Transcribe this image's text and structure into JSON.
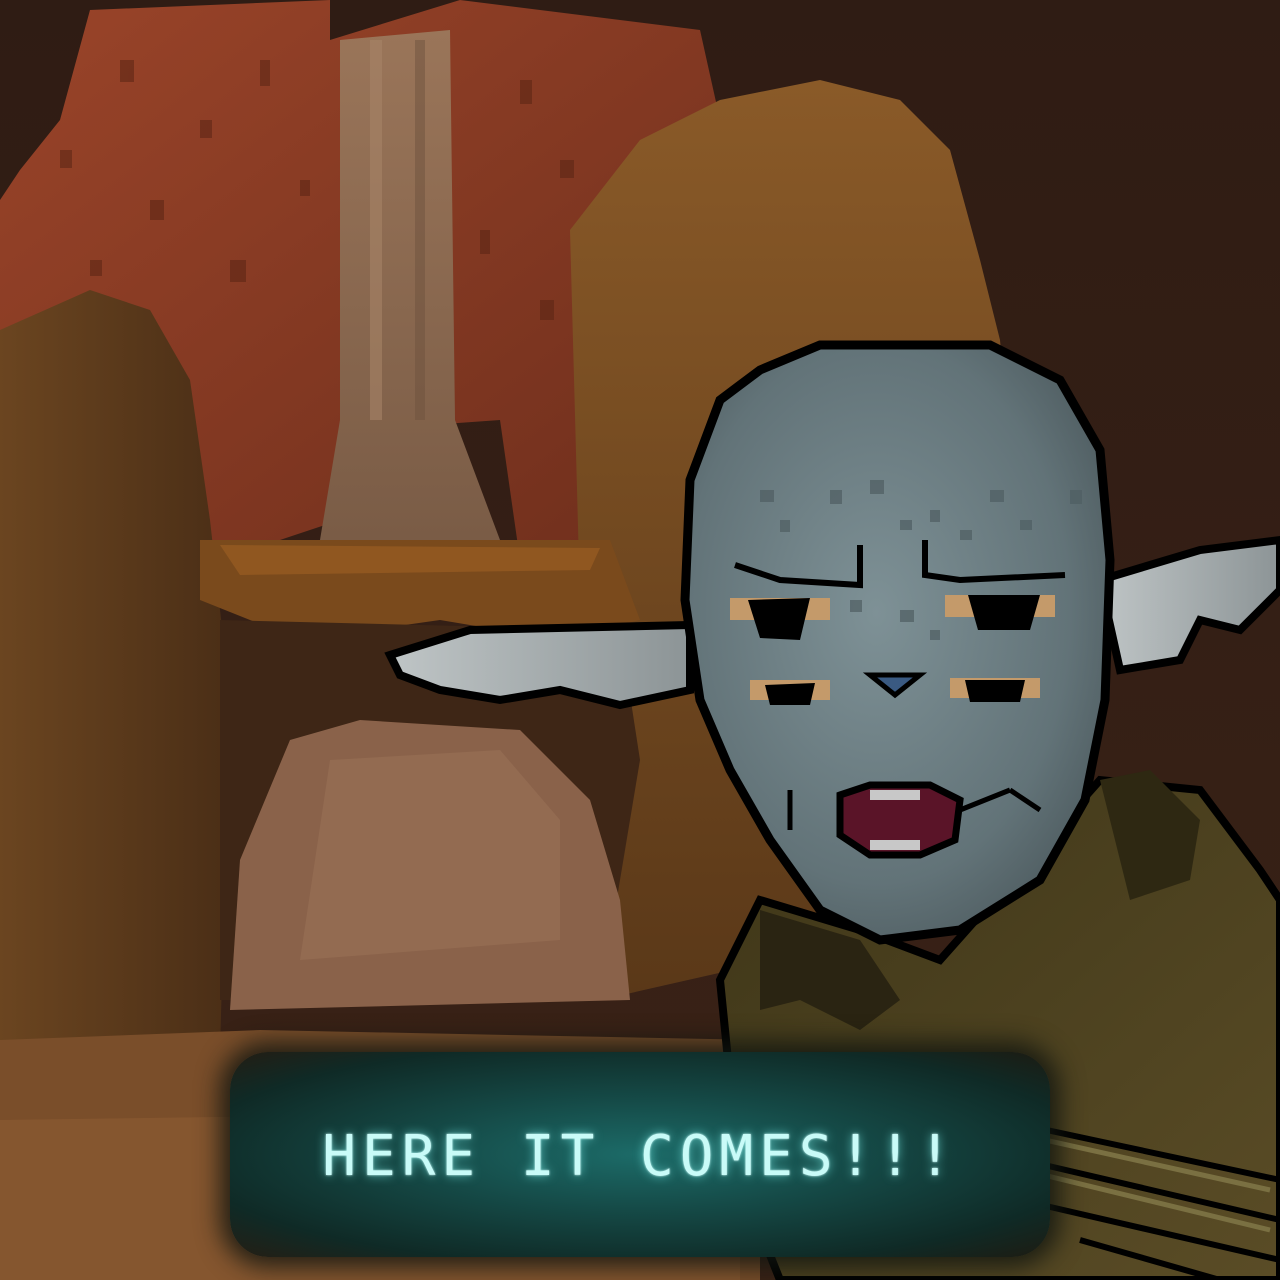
{
  "dialogue": {
    "text": "HERE IT COMES!!!"
  },
  "scene": {
    "character_icon": "goblin-character",
    "palette": {
      "background": "#2e1c14",
      "cliff": "#8a3d24",
      "waterfall": "#8c6b54",
      "hill": "#7a4e26",
      "skin": "#6c7d82",
      "dialogue_text": "#c9fbf8",
      "dialogue_box": "#1c6b68"
    }
  }
}
